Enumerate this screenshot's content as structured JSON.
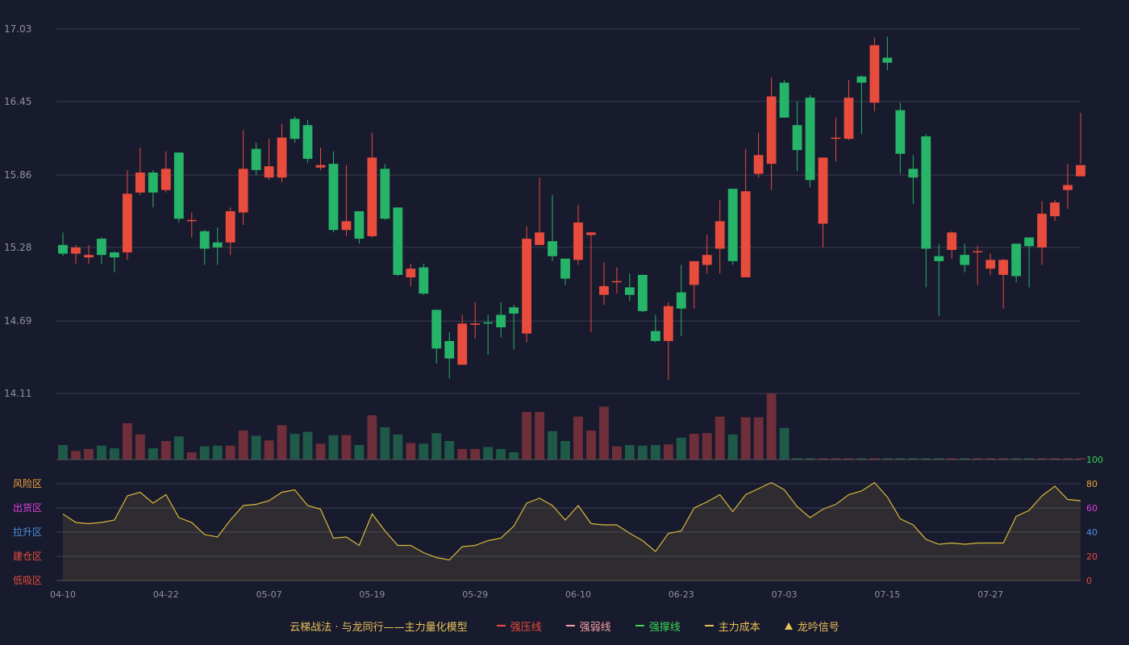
{
  "legend": {
    "title": "云梯战法 · 与龙同行——主力量化模型",
    "items": [
      {
        "label": "强压线",
        "color": "#e84c3d",
        "style": "solid"
      },
      {
        "label": "强弱线",
        "color": "#f4a3a8",
        "style": "dash"
      },
      {
        "label": "强撑线",
        "color": "#36d656",
        "style": "solid"
      },
      {
        "label": "主力成本",
        "color": "#e8c25a",
        "style": "dash"
      },
      {
        "label": "龙吟信号",
        "color": "#e8c25a",
        "style": "tri"
      }
    ]
  },
  "colors": {
    "up": "#e84c3d",
    "down": "#26b469",
    "grid": "#3a3d52",
    "axis_text": "#8f92a0",
    "osc_line": "#d8b83a"
  },
  "chart_data": [
    {
      "type": "candlestick",
      "ylim": [
        14.11,
        17.03
      ],
      "y_ticks": [
        "17.03",
        "16.45",
        "15.86",
        "15.28",
        "14.69",
        "14.11"
      ],
      "x_ticks": [
        {
          "label": "04-10",
          "index": 0
        },
        {
          "label": "04-22",
          "index": 8
        },
        {
          "label": "05-07",
          "index": 16
        },
        {
          "label": "05-19",
          "index": 24
        },
        {
          "label": "05-29",
          "index": 32
        },
        {
          "label": "06-10",
          "index": 40
        },
        {
          "label": "06-23",
          "index": 48
        },
        {
          "label": "07-03",
          "index": 56
        },
        {
          "label": "07-15",
          "index": 64
        },
        {
          "label": "07-27",
          "index": 72
        }
      ],
      "candles": [
        [
          15.3,
          15.23,
          15.4,
          15.21
        ],
        [
          15.23,
          15.28,
          15.3,
          15.15
        ],
        [
          15.2,
          15.22,
          15.3,
          15.15
        ],
        [
          15.35,
          15.22,
          15.36,
          15.15
        ],
        [
          15.24,
          15.2,
          15.25,
          15.08
        ],
        [
          15.24,
          15.71,
          15.9,
          15.18
        ],
        [
          15.72,
          15.88,
          16.08,
          15.7
        ],
        [
          15.88,
          15.72,
          15.9,
          15.6
        ],
        [
          15.74,
          15.91,
          16.05,
          15.72
        ],
        [
          16.04,
          15.51,
          16.04,
          15.48
        ],
        [
          15.49,
          15.5,
          15.56,
          15.36
        ],
        [
          15.41,
          15.27,
          15.42,
          15.14
        ],
        [
          15.32,
          15.28,
          15.44,
          15.14
        ],
        [
          15.32,
          15.57,
          15.6,
          15.22
        ],
        [
          15.56,
          15.91,
          16.22,
          15.46
        ],
        [
          16.07,
          15.9,
          16.12,
          15.86
        ],
        [
          15.84,
          15.93,
          16.15,
          15.82
        ],
        [
          15.84,
          16.16,
          16.27,
          15.8
        ],
        [
          16.31,
          16.15,
          16.33,
          16.12
        ],
        [
          16.26,
          15.99,
          16.3,
          15.96
        ],
        [
          15.92,
          15.94,
          16.08,
          15.9
        ],
        [
          15.95,
          15.42,
          16.05,
          15.4
        ],
        [
          15.42,
          15.49,
          15.94,
          15.37
        ],
        [
          15.57,
          15.35,
          15.57,
          15.31
        ],
        [
          15.37,
          16.0,
          16.2,
          15.36
        ],
        [
          15.91,
          15.51,
          15.95,
          15.5
        ],
        [
          15.6,
          15.06,
          15.6,
          15.05
        ],
        [
          15.04,
          15.11,
          15.15,
          14.97
        ],
        [
          15.12,
          14.91,
          15.15,
          14.9
        ],
        [
          14.78,
          14.47,
          14.78,
          14.35
        ],
        [
          14.53,
          14.39,
          14.6,
          14.23
        ],
        [
          14.34,
          14.67,
          14.74,
          14.34
        ],
        [
          14.66,
          14.67,
          14.84,
          14.55
        ],
        [
          14.68,
          14.67,
          14.74,
          14.42
        ],
        [
          14.74,
          14.64,
          14.84,
          14.56
        ],
        [
          14.8,
          14.75,
          14.82,
          14.46
        ],
        [
          14.59,
          15.35,
          15.45,
          14.52
        ],
        [
          15.3,
          15.4,
          15.84,
          15.3
        ],
        [
          15.33,
          15.21,
          15.7,
          15.17
        ],
        [
          15.19,
          15.03,
          15.19,
          14.98
        ],
        [
          15.18,
          15.48,
          15.62,
          15.14
        ],
        [
          15.38,
          15.4,
          15.4,
          14.6
        ],
        [
          14.9,
          14.97,
          15.16,
          14.82
        ],
        [
          15.01,
          15.01,
          15.12,
          14.91
        ],
        [
          14.96,
          14.9,
          15.07,
          14.85
        ],
        [
          15.06,
          14.77,
          15.06,
          14.76
        ],
        [
          14.61,
          14.53,
          14.74,
          14.52
        ],
        [
          14.53,
          14.81,
          14.84,
          14.22
        ],
        [
          14.92,
          14.79,
          15.14,
          14.57
        ],
        [
          14.98,
          15.17,
          15.17,
          14.79
        ],
        [
          15.14,
          15.22,
          15.38,
          15.07
        ],
        [
          15.27,
          15.49,
          15.66,
          15.07
        ],
        [
          15.75,
          15.17,
          15.75,
          15.14
        ],
        [
          15.04,
          15.73,
          16.07,
          15.04
        ],
        [
          15.87,
          16.02,
          16.2,
          15.84
        ],
        [
          15.95,
          16.49,
          16.64,
          15.74
        ],
        [
          16.6,
          16.32,
          16.62,
          16.32
        ],
        [
          16.26,
          16.06,
          16.45,
          15.89
        ],
        [
          16.48,
          15.82,
          16.5,
          15.76
        ],
        [
          15.47,
          16.0,
          16.0,
          15.28
        ],
        [
          16.15,
          16.16,
          16.32,
          15.97
        ],
        [
          16.15,
          16.48,
          16.62,
          16.14
        ],
        [
          16.65,
          16.6,
          16.66,
          16.19
        ],
        [
          16.44,
          16.9,
          16.96,
          16.37
        ],
        [
          16.8,
          16.76,
          16.97,
          16.7
        ],
        [
          16.38,
          16.03,
          16.44,
          15.87
        ],
        [
          15.91,
          15.84,
          16.02,
          15.63
        ],
        [
          16.17,
          15.27,
          16.19,
          14.96
        ],
        [
          15.21,
          15.17,
          15.31,
          14.73
        ],
        [
          15.26,
          15.4,
          15.41,
          15.19
        ],
        [
          15.22,
          15.14,
          15.31,
          15.08
        ],
        [
          15.25,
          15.25,
          15.29,
          14.98
        ],
        [
          15.11,
          15.18,
          15.23,
          15.06
        ],
        [
          15.06,
          15.18,
          15.19,
          14.79
        ],
        [
          15.31,
          15.05,
          15.31,
          15.0
        ],
        [
          15.36,
          15.29,
          15.36,
          14.96
        ],
        [
          15.28,
          15.55,
          15.65,
          15.14
        ],
        [
          15.53,
          15.64,
          15.66,
          15.49
        ],
        [
          15.74,
          15.78,
          15.95,
          15.59
        ],
        [
          15.85,
          15.94,
          16.36,
          15.95
        ]
      ]
    },
    {
      "type": "bar",
      "name": "volume",
      "ylim": [
        0,
        100
      ],
      "values": [
        22,
        13,
        16,
        21,
        17,
        55,
        38,
        17,
        28,
        35,
        11,
        20,
        21,
        21,
        44,
        36,
        29,
        52,
        39,
        42,
        24,
        37,
        37,
        22,
        67,
        49,
        38,
        25,
        24,
        40,
        28,
        16,
        16,
        19,
        16,
        11,
        72,
        72,
        43,
        28,
        65,
        44,
        80,
        20,
        22,
        21,
        22,
        23,
        33,
        39,
        40,
        65,
        38,
        64,
        64,
        100,
        48,
        2,
        2,
        2,
        2,
        2,
        2,
        2,
        2,
        2,
        2,
        2,
        2,
        2,
        2,
        2,
        2,
        2,
        2,
        2,
        2,
        2,
        2,
        2
      ]
    },
    {
      "type": "area",
      "name": "oscillator",
      "ylim": [
        0,
        100
      ],
      "right_ticks": [
        {
          "label": "100",
          "value": 100,
          "color": "#36d656"
        },
        {
          "label": "80",
          "value": 80,
          "color": "#f0a33a"
        },
        {
          "label": "60",
          "value": 60,
          "color": "#e040e0"
        },
        {
          "label": "40",
          "value": 40,
          "color": "#4a90e2"
        },
        {
          "label": "20",
          "value": 20,
          "color": "#e84c3d"
        },
        {
          "label": "0",
          "value": 0,
          "color": "#e84c3d"
        }
      ],
      "zones": [
        {
          "label": "风险区",
          "value": 80,
          "color": "#f0a33a"
        },
        {
          "label": "出货区",
          "value": 60,
          "color": "#e040e0"
        },
        {
          "label": "拉升区",
          "value": 40,
          "color": "#4a90e2"
        },
        {
          "label": "建仓区",
          "value": 20,
          "color": "#e84c3d"
        },
        {
          "label": "低吸区",
          "value": 0,
          "color": "#e84c3d"
        }
      ],
      "values": [
        55,
        48,
        47,
        48,
        50,
        70,
        73,
        64,
        71,
        52,
        48,
        38,
        36,
        50,
        62,
        63,
        66,
        73,
        75,
        62,
        59,
        35,
        36,
        29,
        55,
        41,
        29,
        29,
        23,
        19,
        17,
        28,
        29,
        33,
        35,
        45,
        64,
        68,
        62,
        50,
        62,
        47,
        46,
        46,
        39,
        33,
        24,
        39,
        41,
        60,
        65,
        71,
        57,
        71,
        76,
        81,
        75,
        61,
        52,
        59,
        63,
        71,
        74,
        81,
        69,
        51,
        46,
        34,
        30,
        31,
        30,
        31,
        31,
        31,
        53,
        58,
        70,
        78,
        67,
        66
      ]
    }
  ]
}
